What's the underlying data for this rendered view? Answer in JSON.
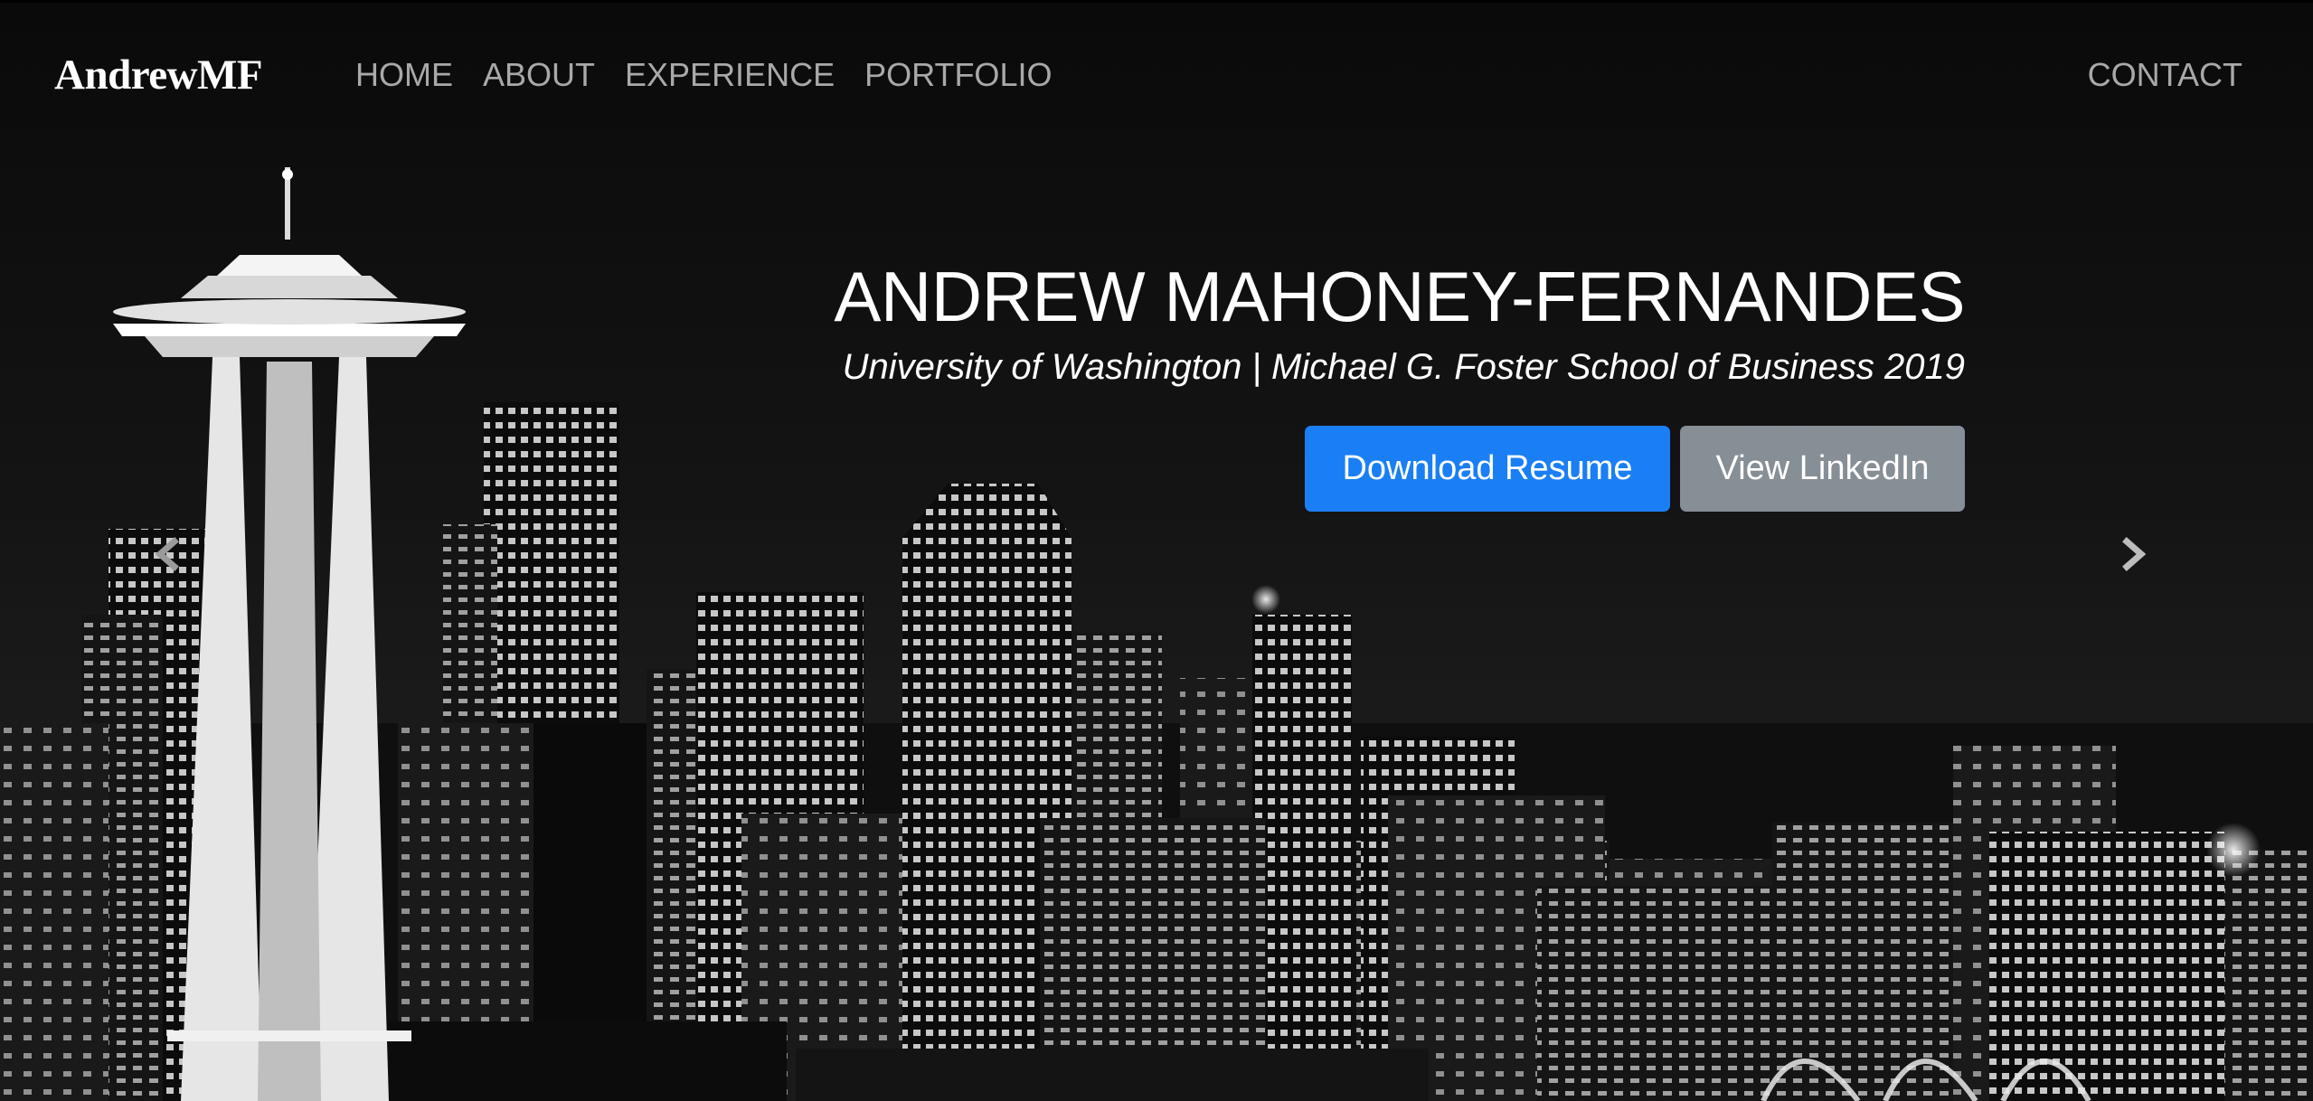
{
  "nav": {
    "brand": "AndrewMF",
    "links": [
      "HOME",
      "ABOUT",
      "EXPERIENCE",
      "PORTFOLIO"
    ],
    "contact": "CONTACT"
  },
  "hero": {
    "title": "ANDREW MAHONEY-FERNANDES",
    "subtitle": "University of Washington | Michael G. Foster School of Business 2019",
    "primary_button": "Download Resume",
    "secondary_button": "View LinkedIn"
  },
  "carousel": {
    "prev_icon": "chevron-left-icon",
    "next_icon": "chevron-right-icon"
  },
  "colors": {
    "primary": "#1a7ff4",
    "secondary": "#868e96",
    "nav_text": "#a9a9a9"
  }
}
